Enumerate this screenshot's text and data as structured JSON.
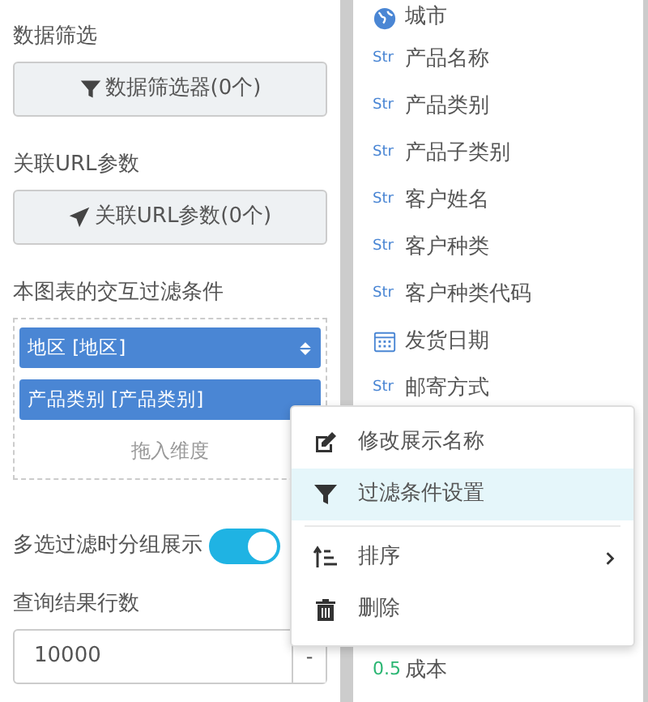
{
  "settings": {
    "filter_label": "数据筛选",
    "filter_button": "数据筛选器(0个)",
    "url_label": "关联URL参数",
    "url_button": "关联URL参数(0个)",
    "interaction_label": "本图表的交互过滤条件",
    "interaction_filters": [
      {
        "label": "地区 [地区]",
        "sortable": true
      },
      {
        "label": "产品类别 [产品类别]",
        "sortable": false
      }
    ],
    "drop_hint": "拖入维度",
    "group_toggle": {
      "label": "多选过滤时分组展示",
      "on": true
    },
    "rows_label": "查询结果行数",
    "rows_value": "10000",
    "rows_button": "-"
  },
  "fields": [
    {
      "kind": "geo",
      "name": "城市"
    },
    {
      "kind": "str",
      "type_label": "Str",
      "name": "产品名称"
    },
    {
      "kind": "str",
      "type_label": "Str",
      "name": "产品类别"
    },
    {
      "kind": "str",
      "type_label": "Str",
      "name": "产品子类别"
    },
    {
      "kind": "str",
      "type_label": "Str",
      "name": "客户姓名"
    },
    {
      "kind": "str",
      "type_label": "Str",
      "name": "客户种类"
    },
    {
      "kind": "str",
      "type_label": "Str",
      "name": "客户种类代码"
    },
    {
      "kind": "date",
      "name": "发货日期"
    },
    {
      "kind": "str",
      "type_label": "Str",
      "name": "邮寄方式"
    },
    {
      "kind": "measure",
      "type_label": "0.5",
      "name": "成本"
    }
  ],
  "context_menu": [
    {
      "kind": "edit",
      "label": "修改展示名称",
      "selected": false
    },
    {
      "kind": "filter",
      "label": "过滤条件设置",
      "selected": true
    },
    {
      "kind": "divider"
    },
    {
      "kind": "sort",
      "label": "排序",
      "submenu": true,
      "selected": false
    },
    {
      "kind": "delete",
      "label": "删除",
      "selected": false
    }
  ]
}
